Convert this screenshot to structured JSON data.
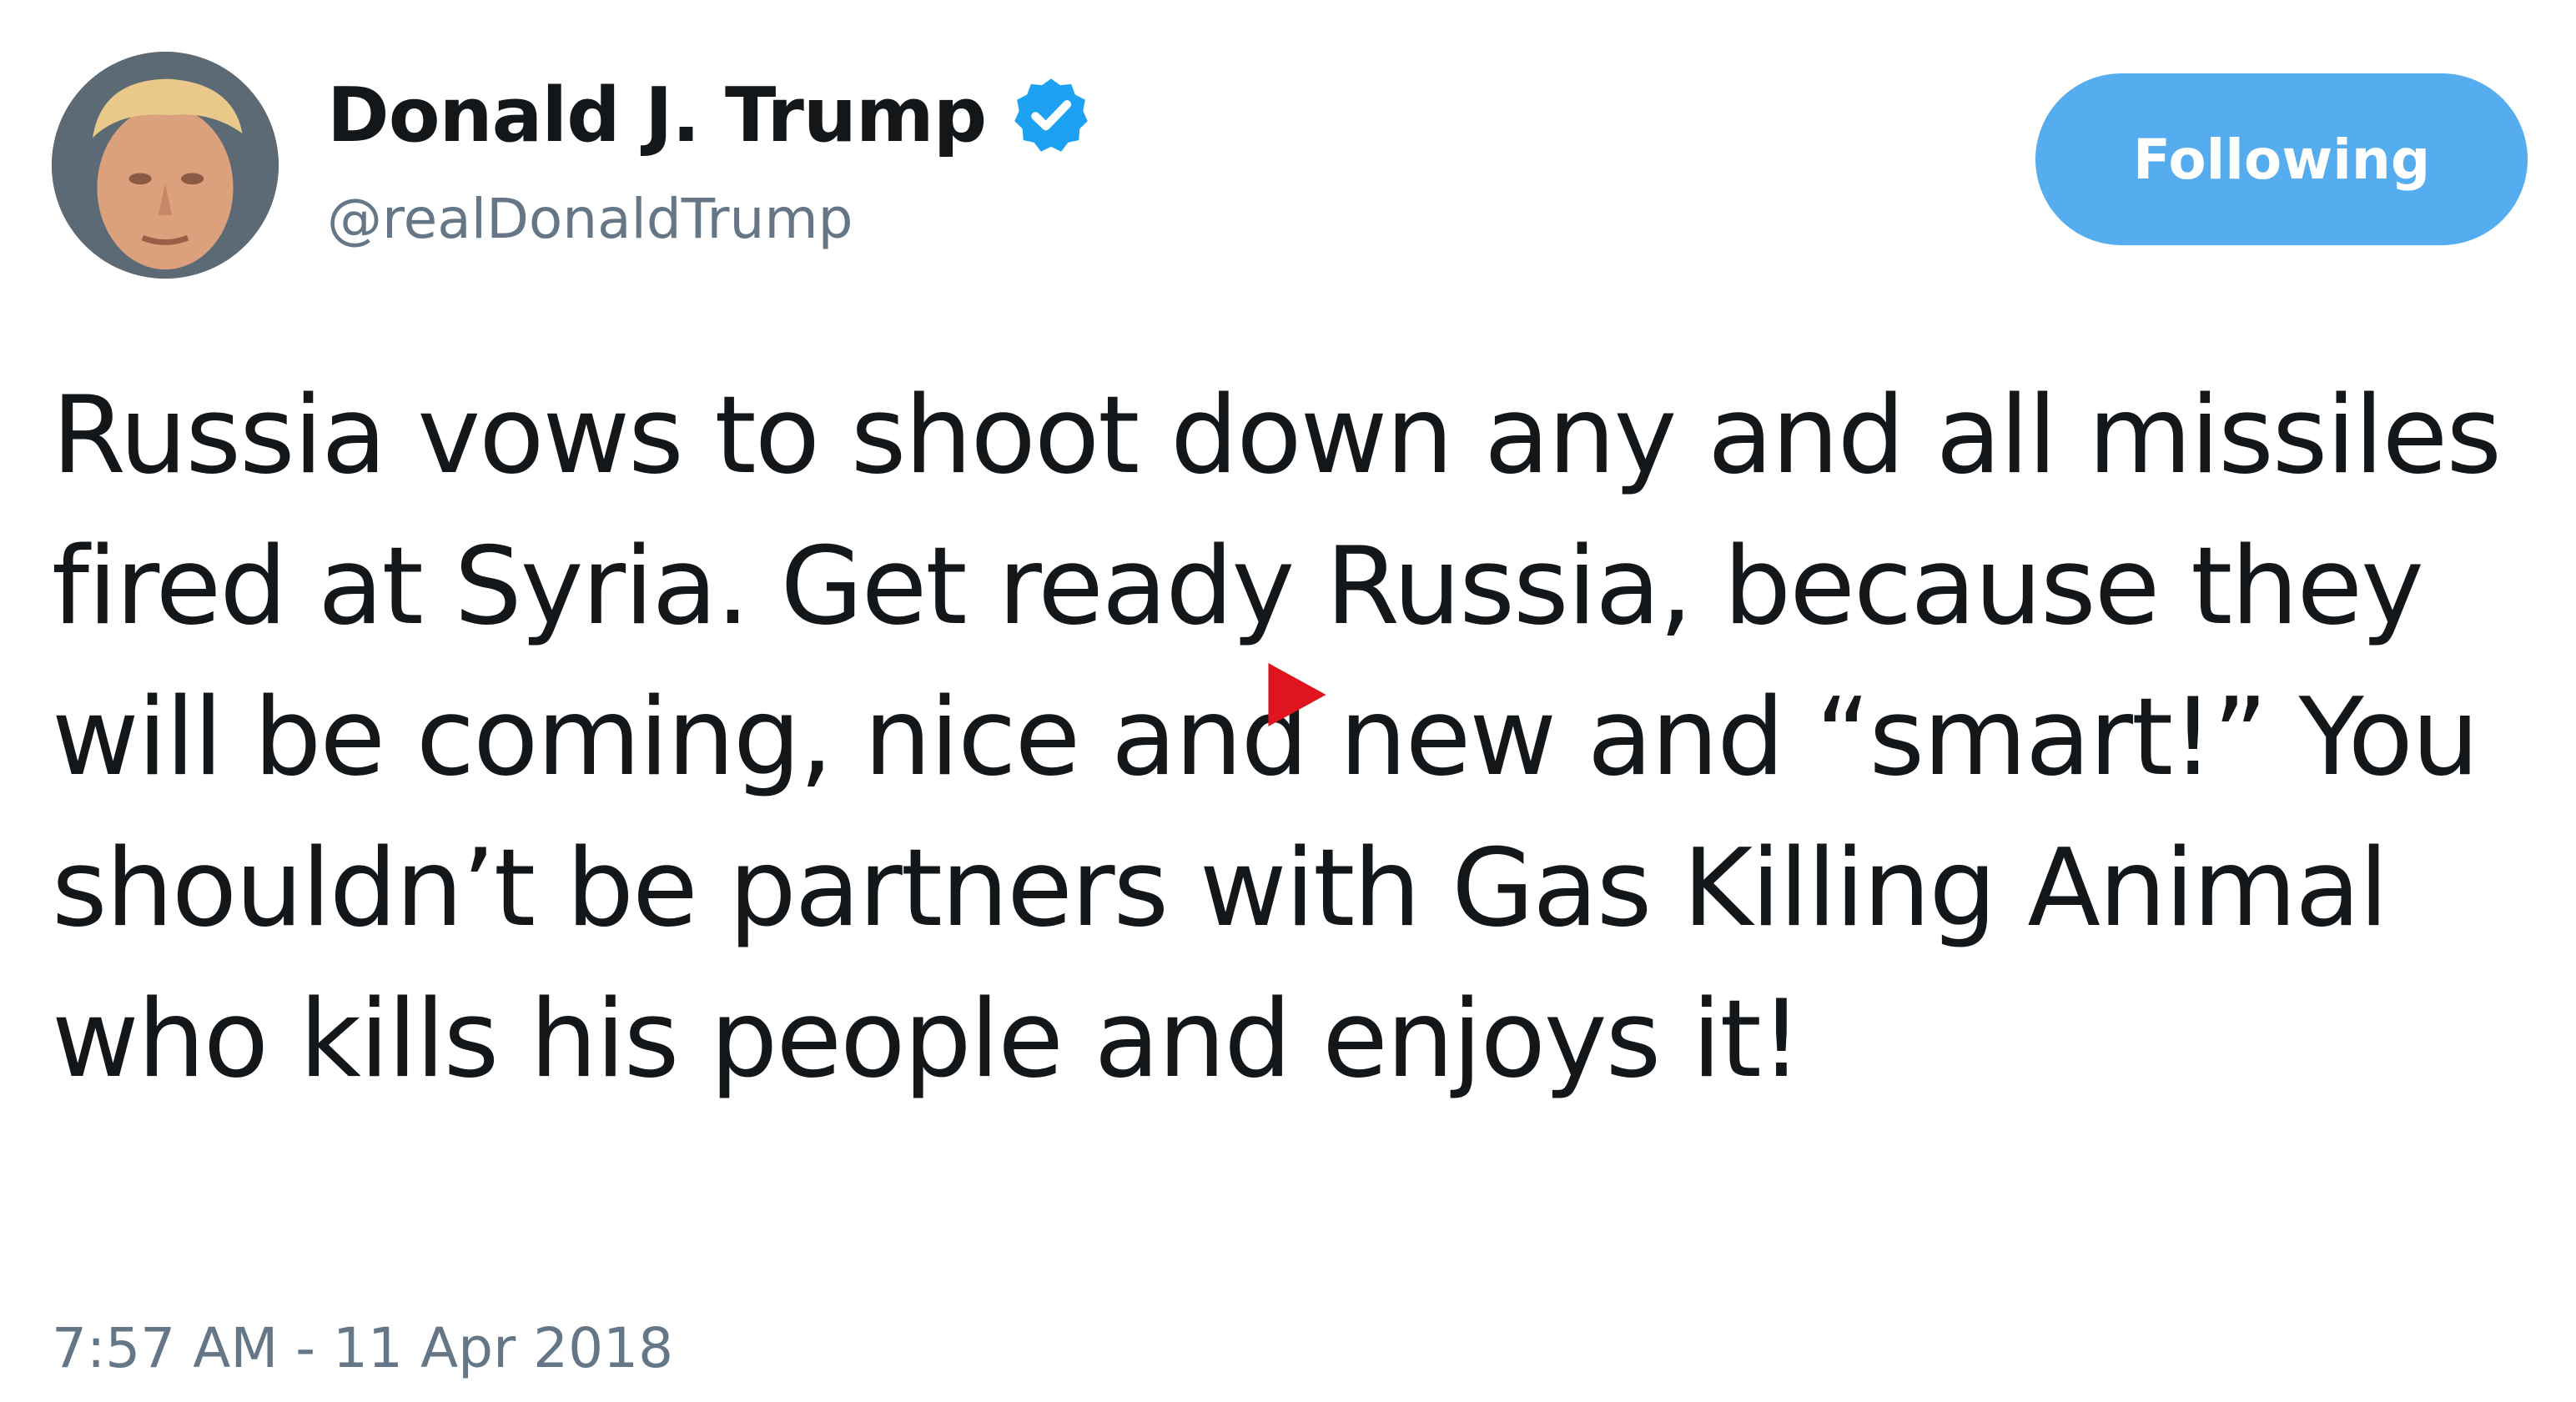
{
  "author": {
    "display_name": "Donald J. Trump",
    "handle": "@realDonaldTrump",
    "verified": true,
    "avatar_icon": "profile-photo",
    "verified_icon": "verified-badge-icon"
  },
  "follow_button": {
    "label": "Following",
    "color": "#55acee"
  },
  "tweet": {
    "text": "Russia vows to shoot down any and all missiles fired at Syria. Get ready Russia, because they will be coming, nice and new and “smart!” You shouldn’t be partners with Gas Killing Animal who kills his people and enjoys it!",
    "timestamp": "7:57 AM - 11 Apr 2018"
  },
  "overlay": {
    "play_icon": "play-icon",
    "play_color": "#e0141e"
  },
  "colors": {
    "text_primary": "#14171a",
    "text_secondary": "#657786",
    "accent": "#1da1f2"
  }
}
